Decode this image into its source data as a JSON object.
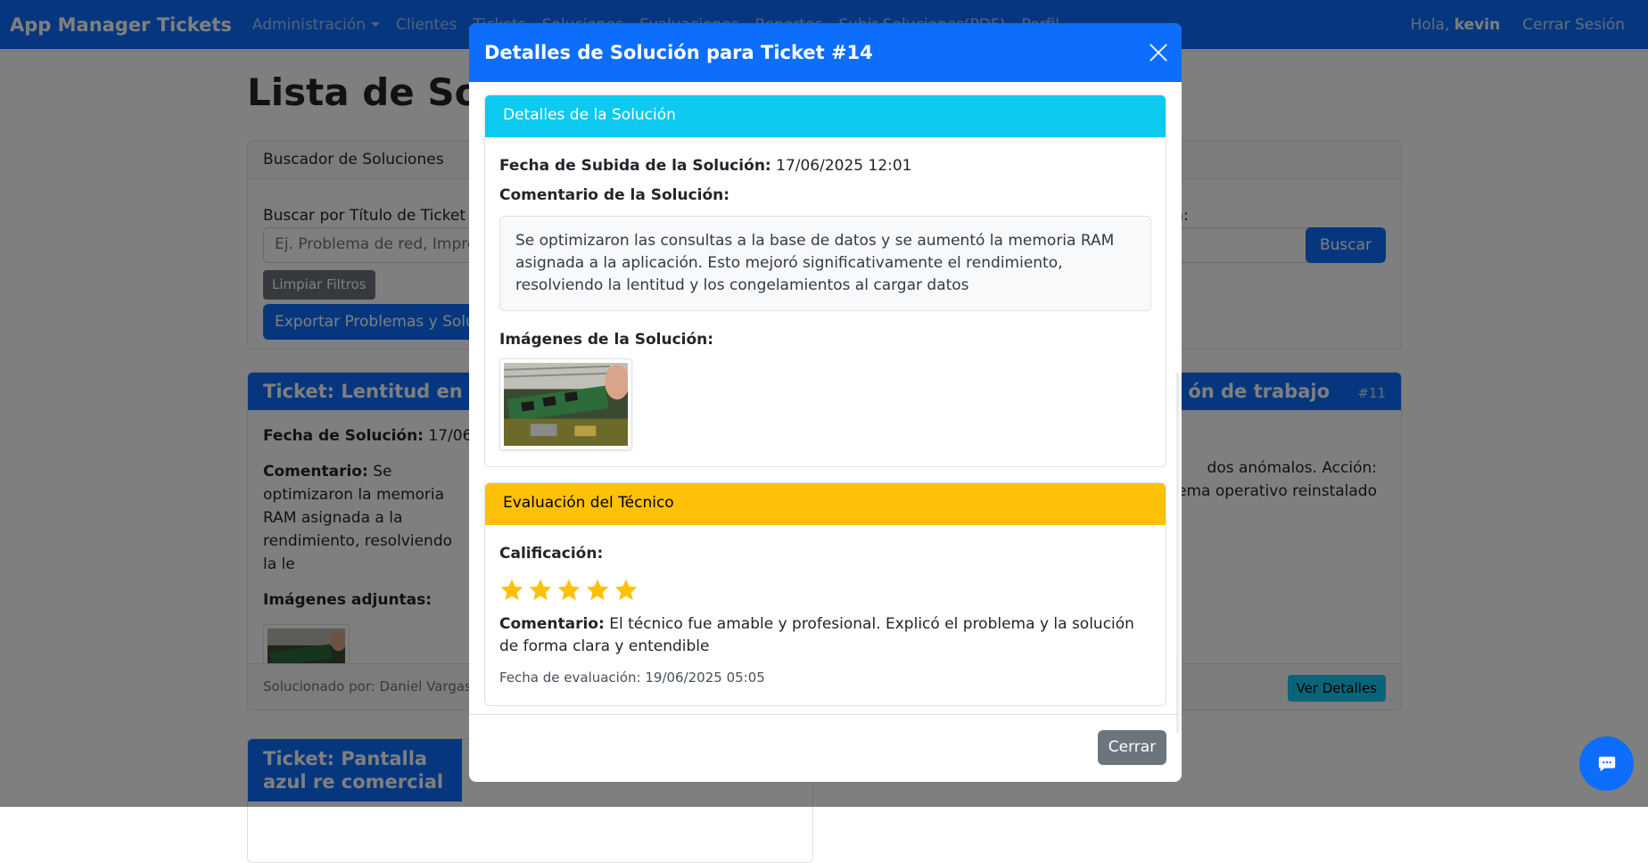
{
  "navbar": {
    "brand": "App Manager Tickets",
    "items": [
      "Administración",
      "Clientes",
      "Tickets",
      "Soluciones",
      "Evaluaciones",
      "Reportes",
      "Subir Soluciones(PDF)",
      "Perfil"
    ],
    "greeting_prefix": "Hola, ",
    "username": "kevin",
    "logout": "Cerrar Sesión"
  },
  "page": {
    "title": "Lista de Solu",
    "search_card": {
      "header": "Buscador de Soluciones",
      "label_search": "Buscar por Título de Ticket o C",
      "label_date": "ta:",
      "search_placeholder": "Ej. Problema de red, Impreso",
      "btn_search": "Buscar",
      "btn_clear": "Limpiar Filtros",
      "btn_export": "Exportar Problemas y Soluc"
    },
    "ticket1": {
      "title": "Ticket: Lentitud en apli",
      "date_label": "Fecha de Solución:",
      "date_value": " 17/06/20",
      "comment_label": "Comentario:",
      "comment_text": " Se optimizaron la memoria RAM asignada a la rendimiento, resolviendo la le",
      "images_label": "Imágenes adjuntas:",
      "footer": "Solucionado por: Daniel Vargass"
    },
    "ticket2": {
      "title": "ón de trabajo",
      "number": "#11",
      "text": "dos anómalos. Acción: stema operativo reinstalado",
      "btn_details": "Ver Detalles"
    },
    "ticket3": {
      "title": "Ticket: Pantalla azul re comercial"
    }
  },
  "modal": {
    "title": "Detalles de Solución para Ticket #14",
    "solution_card": {
      "header": "Detalles de la Solución",
      "date_label": "Fecha de Subida de la Solución:",
      "date_value": " 17/06/2025 12:01",
      "comment_label": "Comentario de la Solución:",
      "comment_text": "Se optimizaron las consultas a la base de datos y se aumentó la memoria RAM asignada a la aplicación. Esto mejoró significativamente el rendimiento, resolviendo la lentitud y los congelamientos al cargar datos",
      "images_label": "Imágenes de la Solución:"
    },
    "evaluation_card": {
      "header": "Evaluación del Técnico",
      "rating_label": "Calificación:",
      "rating": 5,
      "rating_max": 5,
      "comment_label": "Comentario:",
      "comment_text": " El técnico fue amable y profesional. Explicó el problema y la solución de forma clara y entendible",
      "eval_date": "Fecha de evaluación: 19/06/2025 05:05"
    },
    "btn_close": "Cerrar"
  },
  "colors": {
    "primary": "#0d6efd",
    "info": "#0dcaf0",
    "warning": "#ffc107",
    "secondary": "#6c757d"
  }
}
